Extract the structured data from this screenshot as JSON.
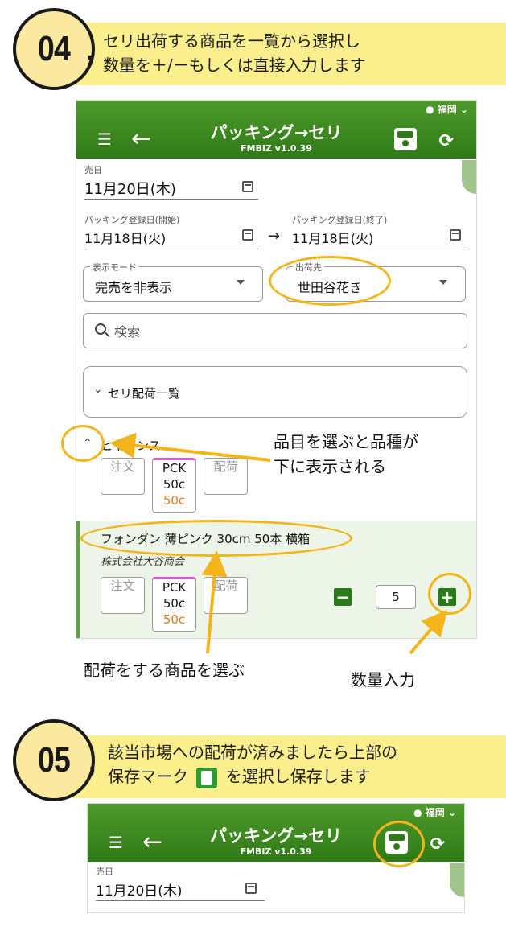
{
  "step4": {
    "number": "04",
    "text_line1": "セリ出荷する商品を一覧から選択し",
    "text_line2": "数量を＋/－もしくは直接入力します"
  },
  "step5": {
    "number": "05",
    "text_line1": "該当市場への配荷が済みましたら上部の",
    "text_line2a": "保存マーク",
    "text_line2b": "を選択し保存します"
  },
  "app": {
    "title": "パッキング→セリ",
    "version": "FMBIZ v1.0.39",
    "account": "福岡",
    "brand_color": "#2f7a17"
  },
  "form": {
    "sale_date_label": "売日",
    "sale_date": "11月20日(木)",
    "packing_start_label": "パッキング登録日(開始)",
    "packing_start": "11月18日(火)",
    "packing_end_label": "パッキング登録日(終了)",
    "packing_end": "11月18日(火)",
    "display_mode_label": "表示モード",
    "display_mode": "完売を非表示",
    "destination_label": "出荷先",
    "destination": "世田谷花き",
    "search_placeholder": "検索"
  },
  "seri_list": {
    "label": "セリ配荷一覧"
  },
  "category": {
    "name": "ヒヤシンス",
    "chips": [
      {
        "label": "注文"
      },
      {
        "label": "PCK",
        "line2": "50c",
        "line3": "50c"
      },
      {
        "label": "配荷"
      }
    ]
  },
  "product": {
    "name": "フォンダン 薄ピンク 30cm 50本 横箱",
    "company": "株式会社大谷商会",
    "chips": [
      {
        "label": "注文"
      },
      {
        "label": "PCK",
        "line2": "50c",
        "line3": "50c"
      },
      {
        "label": "配荷"
      }
    ],
    "quantity": "5"
  },
  "annotations": {
    "select_category": "品目を選ぶと品種が",
    "select_category2": "下に表示される",
    "select_product": "配荷をする商品を選ぶ",
    "quantity_input": "数量入力",
    "highlight_color": "#f3b51b"
  }
}
